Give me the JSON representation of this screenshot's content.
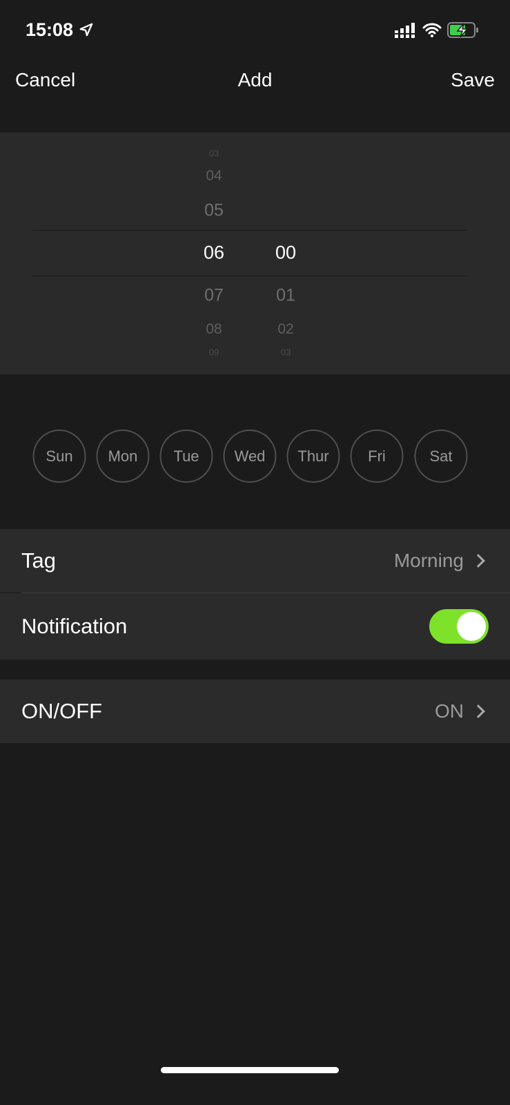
{
  "status_bar": {
    "time": "15:08",
    "icons": [
      "location-arrow-icon",
      "signal-icon",
      "wifi-icon",
      "battery-charging-icon"
    ],
    "battery_color": "#3ecf4a"
  },
  "nav": {
    "cancel": "Cancel",
    "title": "Add",
    "save": "Save"
  },
  "picker": {
    "hours": [
      "03",
      "04",
      "05",
      "06",
      "07",
      "08",
      "09"
    ],
    "minutes": [
      "00",
      "01",
      "02",
      "03"
    ],
    "selected_hour": "06",
    "selected_minute": "00"
  },
  "days": [
    "Sun",
    "Mon",
    "Tue",
    "Wed",
    "Thur",
    "Fri",
    "Sat"
  ],
  "settings": {
    "tag": {
      "label": "Tag",
      "value": "Morning"
    },
    "notification": {
      "label": "Notification",
      "enabled": true,
      "color": "#7ee22a"
    },
    "onoff": {
      "label": "ON/OFF",
      "value": "ON"
    }
  }
}
